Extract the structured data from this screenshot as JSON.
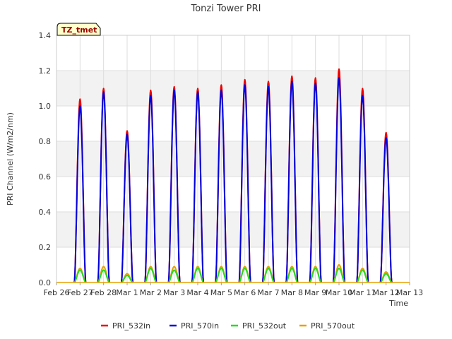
{
  "chart_data": {
    "type": "line",
    "title": "Tonzi Tower PRI",
    "xlabel": "Time",
    "ylabel": "PRI Channel (W/m2/nm)",
    "ylim": [
      0,
      1.4
    ],
    "yticks": [
      "0.0",
      "0.2",
      "0.4",
      "0.6",
      "0.8",
      "1.0",
      "1.2",
      "1.4"
    ],
    "xlim": [
      "2024-02-26",
      "2024-03-13"
    ],
    "xticks": [
      "Feb 26",
      "Feb 27",
      "Feb 28",
      "Mar 1",
      "Mar 2",
      "Mar 3",
      "Mar 4",
      "Mar 5",
      "Mar 6",
      "Mar 7",
      "Mar 8",
      "Mar 9",
      "Mar 10",
      "Mar 11",
      "Mar 12",
      "Mar 13"
    ],
    "grid": true,
    "banded_background": true,
    "legend_position": "bottom",
    "annotation": "TZ_tmet",
    "series": [
      {
        "name": "PRI_532in",
        "color": "#ee0000",
        "x": [
          "Feb 27",
          "Feb 28",
          "Mar 1",
          "Mar 2",
          "Mar 3",
          "Mar 4",
          "Mar 5",
          "Mar 6",
          "Mar 7",
          "Mar 8",
          "Mar 9",
          "Mar 10",
          "Mar 11",
          "Mar 12"
        ],
        "values": [
          1.04,
          1.1,
          0.86,
          1.09,
          1.11,
          1.1,
          1.12,
          1.15,
          1.14,
          1.17,
          1.16,
          1.21,
          1.1,
          0.85
        ]
      },
      {
        "name": "PRI_570in",
        "color": "#0000dd",
        "x": [
          "Feb 27",
          "Feb 28",
          "Mar 1",
          "Mar 2",
          "Mar 3",
          "Mar 4",
          "Mar 5",
          "Mar 6",
          "Mar 7",
          "Mar 8",
          "Mar 9",
          "Mar 10",
          "Mar 11",
          "Mar 12"
        ],
        "values": [
          1.0,
          1.08,
          0.84,
          1.06,
          1.09,
          1.08,
          1.09,
          1.12,
          1.11,
          1.14,
          1.13,
          1.16,
          1.06,
          0.82
        ]
      },
      {
        "name": "PRI_532out",
        "color": "#22dd22",
        "x": [
          "Feb 27",
          "Feb 28",
          "Mar 1",
          "Mar 2",
          "Mar 3",
          "Mar 4",
          "Mar 5",
          "Mar 6",
          "Mar 7",
          "Mar 8",
          "Mar 9",
          "Mar 10",
          "Mar 11",
          "Mar 12"
        ],
        "values": [
          0.07,
          0.07,
          0.04,
          0.08,
          0.07,
          0.08,
          0.08,
          0.08,
          0.08,
          0.08,
          0.08,
          0.08,
          0.07,
          0.05
        ]
      },
      {
        "name": "PRI_570out",
        "color": "#e8a000",
        "x": [
          "Feb 27",
          "Feb 28",
          "Mar 1",
          "Mar 2",
          "Mar 3",
          "Mar 4",
          "Mar 5",
          "Mar 6",
          "Mar 7",
          "Mar 8",
          "Mar 9",
          "Mar 10",
          "Mar 11",
          "Mar 12"
        ],
        "values": [
          0.08,
          0.09,
          0.05,
          0.09,
          0.09,
          0.09,
          0.09,
          0.09,
          0.09,
          0.09,
          0.09,
          0.1,
          0.08,
          0.06
        ]
      }
    ]
  }
}
